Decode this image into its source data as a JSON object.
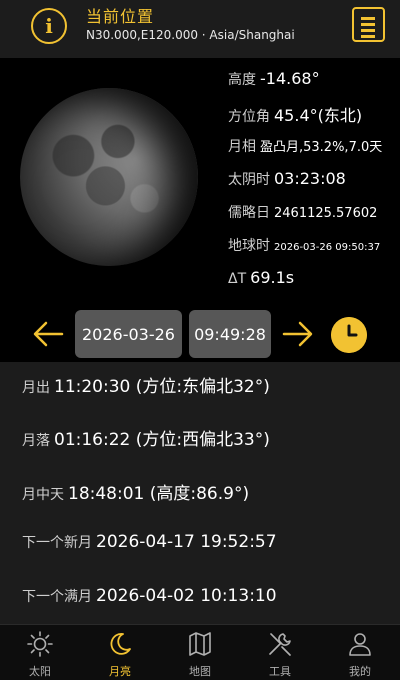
{
  "header": {
    "title": "当前位置",
    "coords": "N30.000,E120.000 · Asia/Shanghai"
  },
  "moon_info": {
    "altitude_label": "高度",
    "altitude_value": "-14.68°",
    "azimuth_label": "方位角",
    "azimuth_value": "45.4°(东北)",
    "phase_label": "月相",
    "phase_value": "盈凸月,53.2%,7.0天",
    "lunar_time_label": "太阴时",
    "lunar_time_value": "03:23:08",
    "julian_label": "儒略日",
    "julian_value": "2461125.57602",
    "tt_label": "地球时",
    "tt_value": "2026-03-26 09:50:37",
    "delta_t_label": "ΔT",
    "delta_t_value": "69.1s"
  },
  "nav": {
    "date": "2026-03-26",
    "time": "09:49:28"
  },
  "events": [
    {
      "label": "月出",
      "value": "11:20:30 (方位:东偏北32°)"
    },
    {
      "label": "月落",
      "value": "01:16:22 (方位:西偏北33°)"
    },
    {
      "label": "月中天",
      "value": "18:48:01 (高度:86.9°)"
    },
    {
      "label": "下一个新月",
      "value": "2026-04-17 19:52:57"
    },
    {
      "label": "下一个满月",
      "value": "2026-04-02 10:13:10"
    }
  ],
  "tabs": [
    {
      "label": "太阳",
      "icon": "sun-icon"
    },
    {
      "label": "月亮",
      "icon": "moon-icon",
      "active": true
    },
    {
      "label": "地图",
      "icon": "map-icon"
    },
    {
      "label": "工具",
      "icon": "tools-icon"
    },
    {
      "label": "我的",
      "icon": "user-icon"
    }
  ],
  "colors": {
    "accent": "#f2c232",
    "background": "#1c1c1c",
    "panel": "#000000",
    "button": "#575757"
  }
}
